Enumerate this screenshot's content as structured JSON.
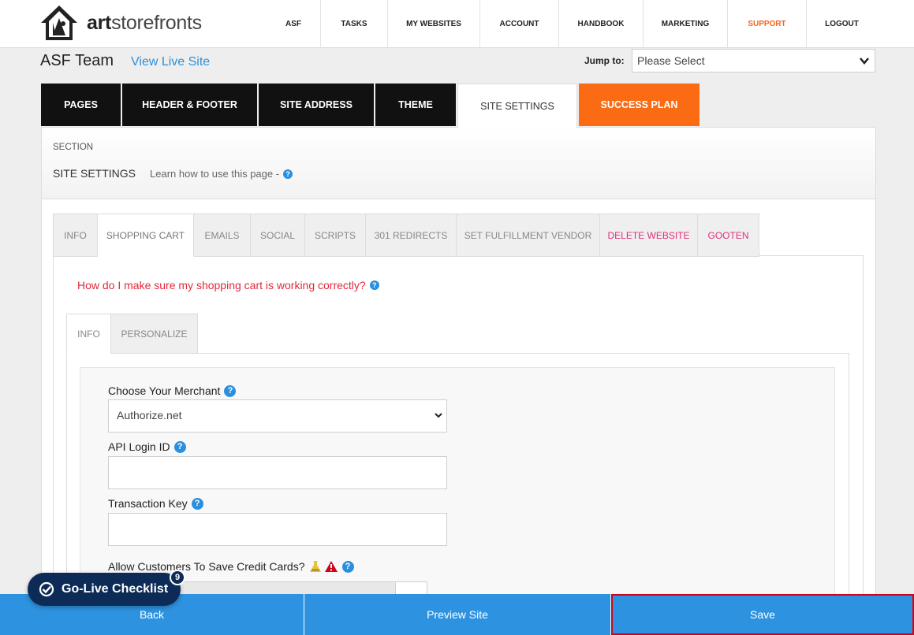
{
  "brand": {
    "logo_text_bold": "art",
    "logo_text_rest": "storefronts"
  },
  "nav": {
    "items": [
      {
        "label": "ASF"
      },
      {
        "label": "TASKS"
      },
      {
        "label": "MY WEBSITES"
      },
      {
        "label": "ACCOUNT"
      },
      {
        "label": "HANDBOOK"
      },
      {
        "label": "MARKETING"
      },
      {
        "label": "SUPPORT",
        "color": "#f26522"
      },
      {
        "label": "LOGOUT"
      }
    ]
  },
  "header": {
    "title": "ASF Team",
    "view_live": "View Live Site",
    "jump_label": "Jump to:",
    "jump_value": "Please Select"
  },
  "main_tabs": [
    {
      "label": "PAGES"
    },
    {
      "label": "HEADER & FOOTER"
    },
    {
      "label": "SITE ADDRESS"
    },
    {
      "label": "THEME"
    },
    {
      "label": "SITE SETTINGS",
      "active": true
    },
    {
      "label": "SUCCESS PLAN",
      "color": "#fa6b13"
    }
  ],
  "section": {
    "label": "SECTION",
    "title": "SITE SETTINGS",
    "learn": "Learn how to use this page -"
  },
  "sub_tabs": [
    {
      "label": "INFO"
    },
    {
      "label": "SHOPPING CART",
      "active": true
    },
    {
      "label": "EMAILS"
    },
    {
      "label": "SOCIAL"
    },
    {
      "label": "SCRIPTS"
    },
    {
      "label": "301 REDIRECTS"
    },
    {
      "label": "SET FULFILLMENT VENDOR"
    },
    {
      "label": "DELETE WEBSITE",
      "color": "#e0307a"
    },
    {
      "label": "GOOTEN",
      "color": "#e0307a"
    }
  ],
  "cart_question": "How do I make sure my shopping cart is working correctly?",
  "inner_tabs": [
    {
      "label": "INFO",
      "active": true
    },
    {
      "label": "PERSONALIZE"
    }
  ],
  "form": {
    "merchant_label": "Choose Your Merchant",
    "merchant_value": "Authorize.net",
    "api_label": "API Login ID",
    "api_value": "",
    "txn_label": "Transaction Key",
    "txn_value": "",
    "save_cards_label": "Allow Customers To Save Credit Cards?"
  },
  "bottom": {
    "back": "Back",
    "preview": "Preview Site",
    "save": "Save"
  },
  "checklist": {
    "label": "Go-Live Checklist",
    "count": "9"
  },
  "colors": {
    "accent": "#2d93e0",
    "orange": "#fa6b13",
    "navy": "#0c2b57",
    "alert": "#d0021b"
  }
}
